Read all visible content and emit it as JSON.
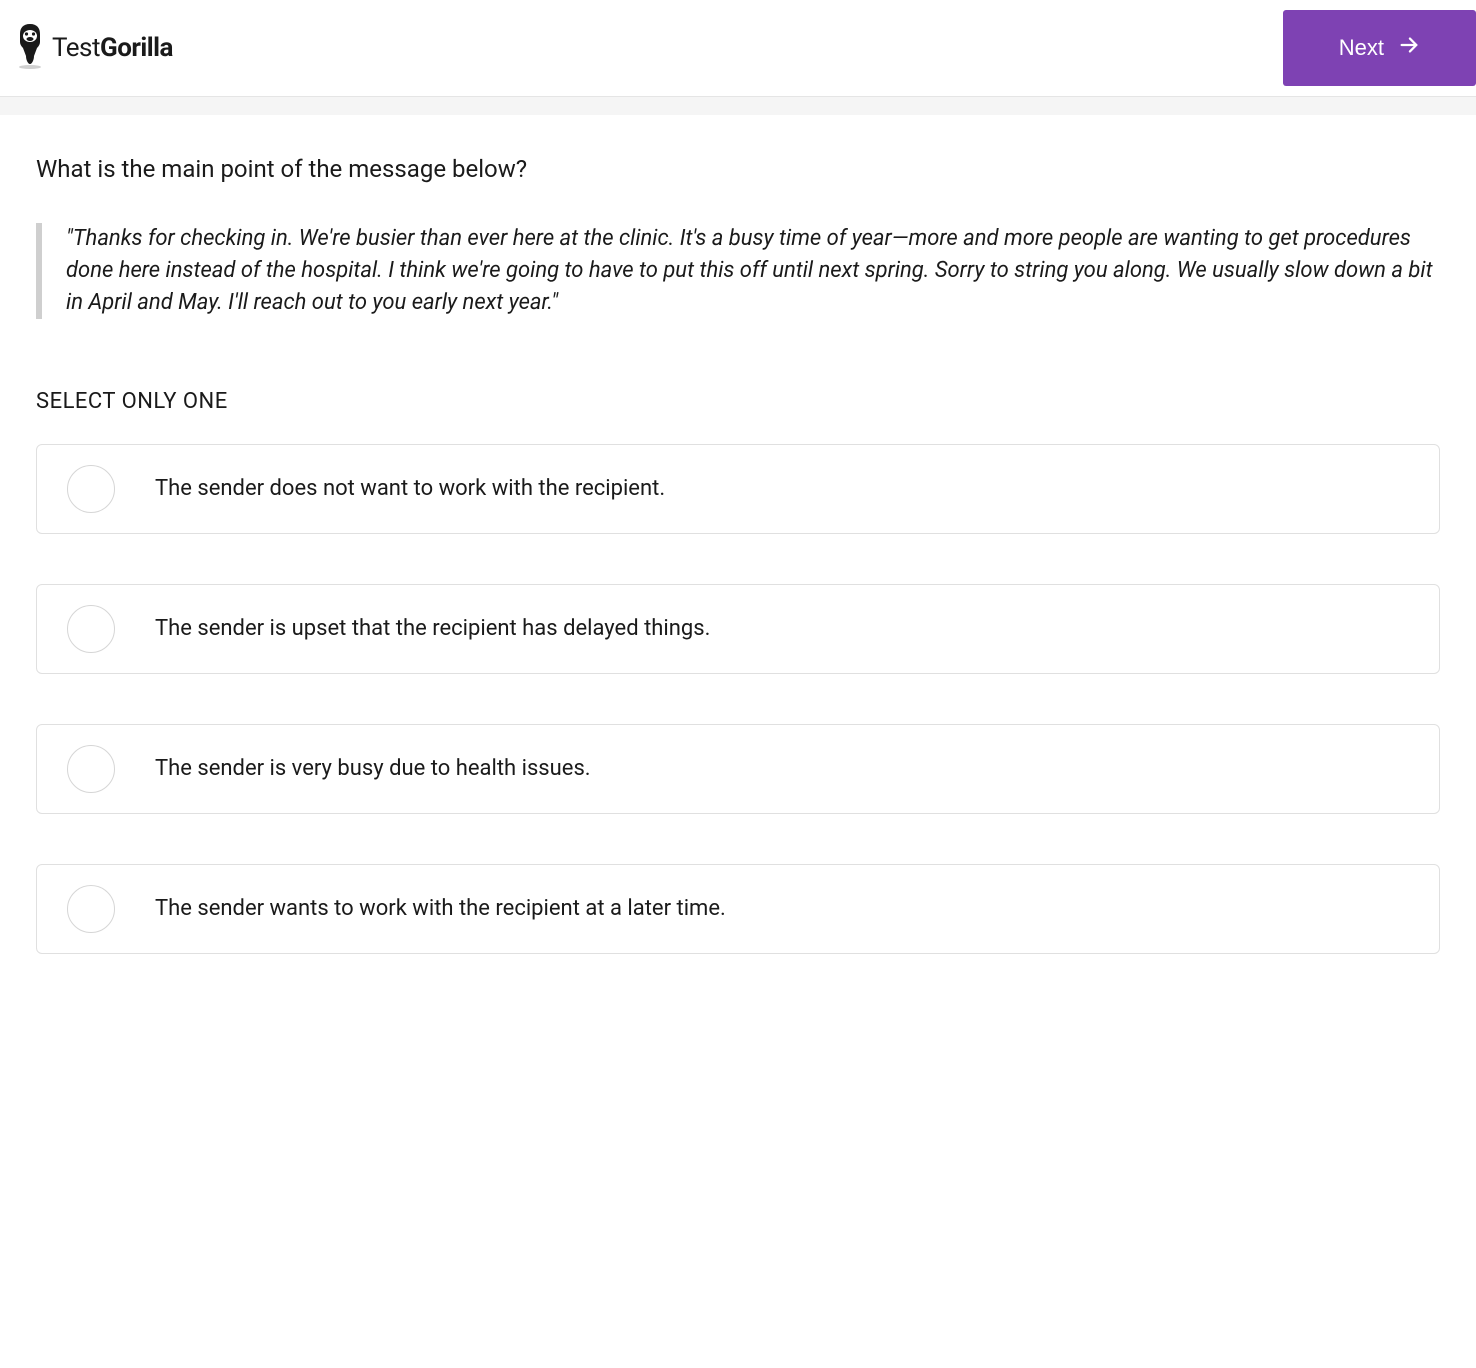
{
  "brand": {
    "name_light": "Test",
    "name_bold": "Gorilla"
  },
  "header": {
    "next_label": "Next"
  },
  "question": {
    "title": "What is the main point of the message below?",
    "quote": "\"Thanks for checking in. We're busier than ever here at the clinic. It's a busy time of year—more and more people are wanting to get procedures done here instead of the hospital. I think we're going to have to put this off until next spring. Sorry to string you along. We usually slow down a bit in April and May. I'll reach out to you early next year.\"",
    "select_label": "SELECT ONLY ONE"
  },
  "options": [
    {
      "label": "The sender does not want to work with the recipient."
    },
    {
      "label": "The sender is upset that the recipient has delayed things."
    },
    {
      "label": "The sender is very busy due to health issues."
    },
    {
      "label": "The sender wants to work with the recipient at a later time."
    }
  ]
}
